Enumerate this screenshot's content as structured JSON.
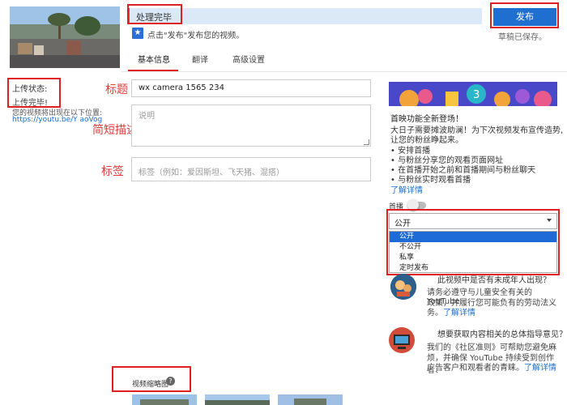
{
  "status": {
    "processing_text": "处理完毕",
    "publish_hint": "点击\"发布\"发布您的视频。",
    "publish_button": "发布",
    "draft_saved": "草稿已保存。"
  },
  "tabs": [
    {
      "label": "基本信息",
      "active": true
    },
    {
      "label": "翻译",
      "active": false
    },
    {
      "label": "高级设置",
      "active": false
    }
  ],
  "left_panel": {
    "upload_status_label": "上传状态:",
    "upload_status_value": "上传完毕!",
    "location_label": "您的视频将出现在以下位置:",
    "location_link": "https://youtu.be/Y        aoVog"
  },
  "annotations": {
    "title": "标题",
    "description": "简短描述",
    "tags": "标签"
  },
  "form": {
    "title_value": "wx camera 1565        234",
    "description_placeholder": "说明",
    "tags_placeholder": "标签（例如：爱因斯坦、飞天猪、混搭）"
  },
  "promo": {
    "badge_number": "3",
    "title": "首映功能全新登场！",
    "lines": [
      "大日子需要摊波助澜！为下次视频发布宣传造势,",
      "让您的粉丝睁起来。",
      "• 安排首播",
      "• 与粉丝分享您的观看页面网址",
      "• 在首播开始之前和首播期间与粉丝聊天",
      "• 与粉丝实时观看首播"
    ],
    "learn_more": "了解详情"
  },
  "premiere": {
    "label": "首播",
    "enabled": false
  },
  "visibility": {
    "selected": "公开",
    "options": [
      "公开",
      "不公开",
      "私享",
      "定时发布"
    ]
  },
  "kids": {
    "question": "此视频中是否有未成年人出现？",
    "text_lines": [
      "请务必遵守与儿童安全有关的 YouTube",
      "政策，并履行您可能负有的劳动法义",
      "务。"
    ],
    "learn_more": "了解详情"
  },
  "guidelines": {
    "question": "想要获取内容相关的总体指导意见？",
    "text_lines": [
      "我们的《社区准则》可帮助您避免麻",
      "烦，并确保 YouTube 持续受到创作者、",
      "广告客户和观看者的青睐。"
    ],
    "learn_more": "了解详情"
  },
  "thumbnails": {
    "label": "视频缩略图"
  },
  "colors": {
    "accent_blue": "#1f6fd1",
    "annotation_red": "#e02020",
    "selected_option": "#1e6bd8"
  }
}
